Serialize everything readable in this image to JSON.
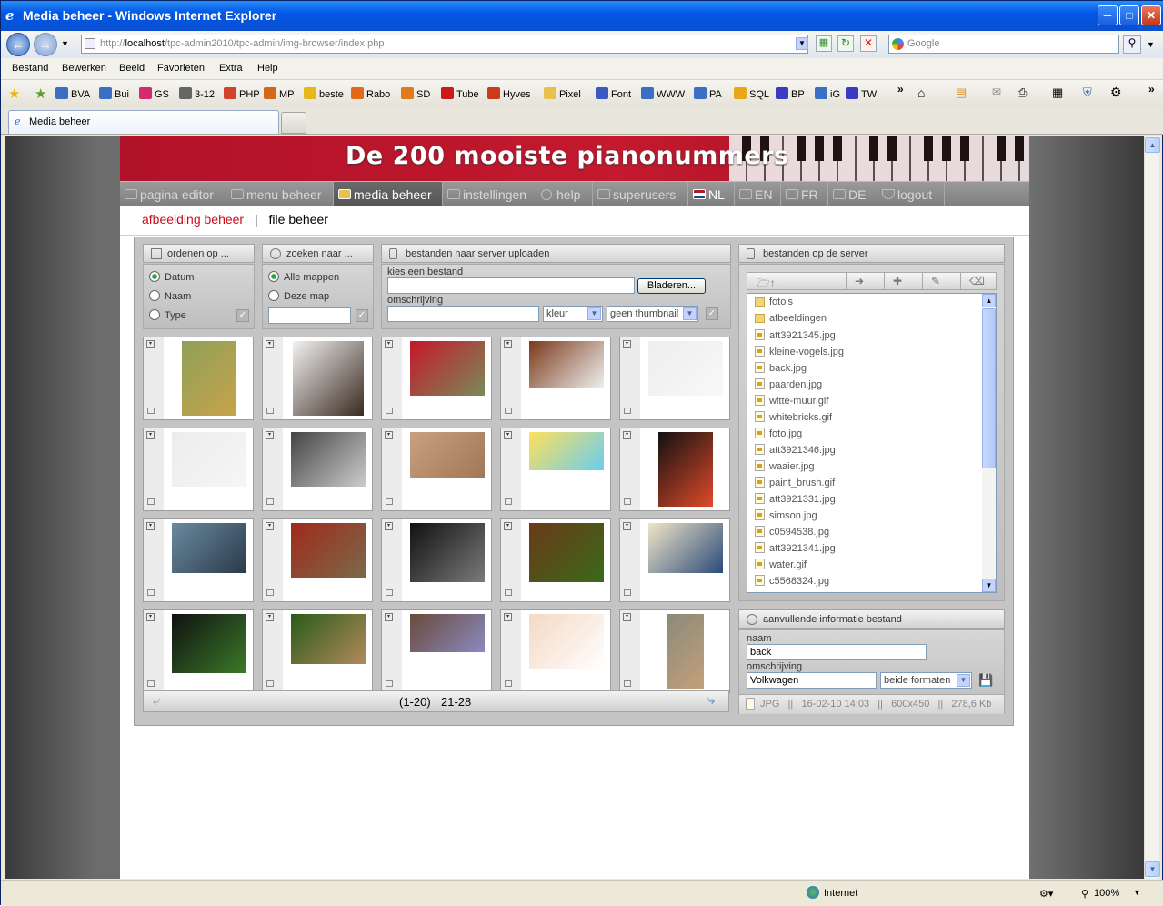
{
  "browser": {
    "title": "Media beheer - Windows Internet Explorer",
    "url_prefix": "http://",
    "url_host": "localhost",
    "url_path": "/tpc-admin2010/tpc-admin/img-browser/index.php",
    "search_placeholder": "Google",
    "menu": [
      "Bestand",
      "Bewerken",
      "Beeld",
      "Favorieten",
      "Extra",
      "Help"
    ],
    "favorites": [
      {
        "label": "BVA",
        "icon": "bva-icon",
        "color": "#3a6fc2"
      },
      {
        "label": "Bui",
        "icon": "globe-icon",
        "color": "#3a6fc2"
      },
      {
        "label": "GS",
        "icon": "gs-icon",
        "color": "#d42a6e"
      },
      {
        "label": "3-12",
        "icon": "page-icon",
        "color": "#666666"
      },
      {
        "label": "PHP",
        "icon": "php-icon",
        "color": "#d2442a"
      },
      {
        "label": "MP",
        "icon": "mp-icon",
        "color": "#d4681a"
      },
      {
        "label": "beste",
        "icon": "star-icon",
        "color": "#e8b81a"
      },
      {
        "label": "Rabo",
        "icon": "rabo-icon",
        "color": "#e06a1a"
      },
      {
        "label": "SD",
        "icon": "sd-icon",
        "color": "#e07a1a"
      },
      {
        "label": "Tube",
        "icon": "youtube-icon",
        "color": "#cc1a1a"
      },
      {
        "label": "Hyves",
        "icon": "hyves-icon",
        "color": "#cc3a1a"
      },
      {
        "label": "Pixel",
        "icon": "folder-icon",
        "color": "#e8c24a"
      },
      {
        "label": "Font",
        "icon": "font-icon",
        "color": "#3a5ac2"
      },
      {
        "label": "WWW",
        "icon": "tools-icon",
        "color": "#3a6fc2"
      },
      {
        "label": "PA",
        "icon": "pa-icon",
        "color": "#3a6fc2"
      },
      {
        "label": "SQL",
        "icon": "pma-icon",
        "color": "#e8a81a"
      },
      {
        "label": "BP",
        "icon": "bp-icon",
        "color": "#3a3ac2"
      },
      {
        "label": "iG",
        "icon": "ig-icon",
        "color": "#3a6fc2"
      },
      {
        "label": "TW",
        "icon": "tw-icon",
        "color": "#3a3ac2"
      }
    ],
    "tab_label": "Media beheer",
    "status_zone": "Internet",
    "zoom": "100%"
  },
  "site": {
    "banner_title": "De 200 mooiste pianonummers",
    "nav": [
      {
        "label": "pagina editor",
        "active": false
      },
      {
        "label": "menu beheer",
        "active": false
      },
      {
        "label": "media beheer",
        "active": true
      },
      {
        "label": "instellingen",
        "active": false
      },
      {
        "label": "help",
        "active": false
      },
      {
        "label": "superusers",
        "active": false
      },
      {
        "label": "NL",
        "active": false
      },
      {
        "label": "EN",
        "active": false
      },
      {
        "label": "FR",
        "active": false
      },
      {
        "label": "DE",
        "active": false
      },
      {
        "label": "logout",
        "active": false
      }
    ],
    "subnav": {
      "active": "afbeelding beheer",
      "sep": "|",
      "other": "file beheer"
    }
  },
  "panels": {
    "order": {
      "title": "ordenen op ...",
      "options": [
        "Datum",
        "Naam",
        "Type"
      ],
      "selected": "Datum"
    },
    "search": {
      "title": "zoeken naar ...",
      "options": [
        "Alle mappen",
        "Deze map"
      ],
      "selected": "Alle mappen",
      "value": ""
    },
    "upload": {
      "title": "bestanden naar server uploaden",
      "file_label": "kies een bestand",
      "browse": "Bladeren...",
      "desc_label": "omschrijving",
      "color_select": "kleur",
      "thumb_select": "geen thumbnail"
    },
    "server": {
      "title": "bestanden op de server",
      "files": [
        {
          "name": "foto's",
          "type": "folder"
        },
        {
          "name": "afbeeldingen",
          "type": "folder"
        },
        {
          "name": "att3921345.jpg",
          "type": "file"
        },
        {
          "name": "kleine-vogels.jpg",
          "type": "file"
        },
        {
          "name": "back.jpg",
          "type": "file"
        },
        {
          "name": "paarden.jpg",
          "type": "file"
        },
        {
          "name": "witte-muur.gif",
          "type": "file"
        },
        {
          "name": "whitebricks.gif",
          "type": "file"
        },
        {
          "name": "foto.jpg",
          "type": "file"
        },
        {
          "name": "att3921346.jpg",
          "type": "file"
        },
        {
          "name": "waaier.jpg",
          "type": "file"
        },
        {
          "name": "paint_brush.gif",
          "type": "file"
        },
        {
          "name": "att3921331.jpg",
          "type": "file"
        },
        {
          "name": "simson.jpg",
          "type": "file"
        },
        {
          "name": "c0594538.jpg",
          "type": "file"
        },
        {
          "name": "att3921341.jpg",
          "type": "file"
        },
        {
          "name": "water.gif",
          "type": "file"
        },
        {
          "name": "c5568324.jpg",
          "type": "file"
        }
      ]
    },
    "info": {
      "title": "aanvullende informatie bestand",
      "name_label": "naam",
      "name_value": "back",
      "desc_label": "omschrijving",
      "desc_value": "Volkwagen",
      "format_select": "beide formaten",
      "status": "JPG   ||   16-02-10 14:03   ||   600x450   ||   278,6 Kb"
    }
  },
  "thumbnails": [
    {
      "img": "dragonfly",
      "c1": "#8fa05a",
      "c2": "#c7a34a",
      "w": 60,
      "h": 82
    },
    {
      "img": "eagles",
      "c1": "#f2f2f2",
      "c2": "#3a2a20",
      "w": 78,
      "h": 82
    },
    {
      "img": "red-car",
      "c1": "#c4182a",
      "c2": "#7a8a5a",
      "w": 82,
      "h": 60
    },
    {
      "img": "horses",
      "c1": "#7a3a1a",
      "c2": "#f0f0f0",
      "w": 82,
      "h": 52
    },
    {
      "img": "white-wall",
      "c1": "#eeeeee",
      "c2": "#f8f8f8",
      "w": 82,
      "h": 60
    },
    {
      "img": "white-bricks",
      "c1": "#ececec",
      "c2": "#f6f6f6",
      "w": 82,
      "h": 60
    },
    {
      "img": "people",
      "c1": "#444444",
      "c2": "#cccccc",
      "w": 82,
      "h": 60
    },
    {
      "img": "desert",
      "c1": "#c9a080",
      "c2": "#a07858",
      "w": 82,
      "h": 50
    },
    {
      "img": "color-fan",
      "c1": "#ffe05a",
      "c2": "#6acdf0",
      "w": 82,
      "h": 42
    },
    {
      "img": "paint-brush",
      "c1": "#111111",
      "c2": "#e04a2a",
      "w": 60,
      "h": 82
    },
    {
      "img": "penguins",
      "c1": "#6a8aa0",
      "c2": "#2a3a4a",
      "w": 82,
      "h": 55
    },
    {
      "img": "motorbike",
      "c1": "#a02a1a",
      "c2": "#7a6a4a",
      "w": 82,
      "h": 60
    },
    {
      "img": "politicians",
      "c1": "#111111",
      "c2": "#7a7a7a",
      "w": 82,
      "h": 65
    },
    {
      "img": "moth",
      "c1": "#6a3a1a",
      "c2": "#3a6a1a",
      "w": 82,
      "h": 65
    },
    {
      "img": "wave",
      "c1": "#f0e6c8",
      "c2": "#2a4a7a",
      "w": 82,
      "h": 55
    },
    {
      "img": "congratulations",
      "c1": "#111111",
      "c2": "#3a7a2a",
      "w": 82,
      "h": 65
    },
    {
      "img": "wood-pile",
      "c1": "#2a5a1a",
      "c2": "#b08a5a",
      "w": 82,
      "h": 55
    },
    {
      "img": "hand-fabric",
      "c1": "#6a4a3a",
      "c2": "#8a8ac0",
      "w": 82,
      "h": 42
    },
    {
      "img": "baby",
      "c1": "#f4d8c4",
      "c2": "#ffffff",
      "w": 82,
      "h": 60
    },
    {
      "img": "cat",
      "c1": "#8a8a7a",
      "c2": "#c4a07a",
      "w": 40,
      "h": 82
    }
  ],
  "pager": {
    "current": "(1-20)",
    "next": "21-28"
  }
}
